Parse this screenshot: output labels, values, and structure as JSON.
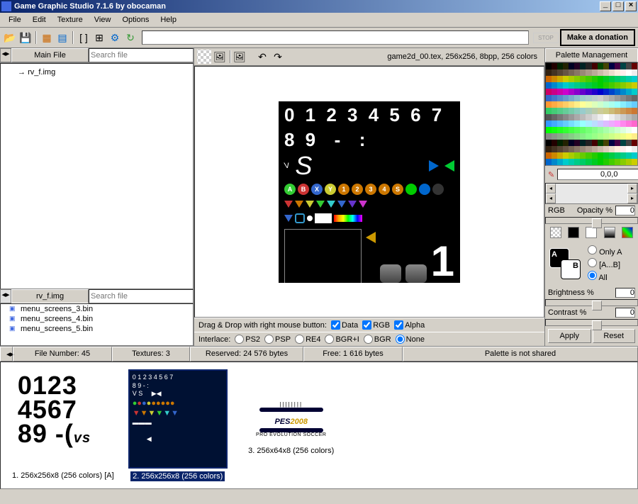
{
  "window": {
    "title": "Game Graphic Studio 7.1.6 by obocaman"
  },
  "menu": {
    "file": "File",
    "edit": "Edit",
    "texture": "Texture",
    "view": "View",
    "options": "Options",
    "help": "Help"
  },
  "toolbar": {
    "search_placeholder": "",
    "stop": "STOP",
    "donate": "Make a donation"
  },
  "left": {
    "main_file": "Main File",
    "search_placeholder": "Search file",
    "tree_item": "rv_f.img",
    "sub_current": "rv_f.img",
    "sub_search": "Search file",
    "sublist": [
      "menu_screens_3.bin",
      "menu_screens_4.bin",
      "menu_screens_5.bin"
    ]
  },
  "center": {
    "info": "game2d_00.tex, 256x256, 8bpp, 256 colors",
    "drag_label": "Drag & Drop with right mouse button:",
    "cb_data": "Data",
    "cb_rgb": "RGB",
    "cb_alpha": "Alpha",
    "interlace_label": "Interlace:",
    "radios": [
      "PS2",
      "PSP",
      "RE4",
      "BGR+I",
      "BGR",
      "None"
    ]
  },
  "right": {
    "header": "Palette Management",
    "color_value": "0,0,0",
    "rgb_label": "RGB",
    "opacity_label": "Opacity %",
    "opacity_val": "0",
    "radio_a": "Only A",
    "radio_ab": "[A...B]",
    "radio_all": "All",
    "brightness": "Brightness %",
    "brightness_val": "0",
    "contrast": "Contrast %",
    "contrast_val": "0",
    "apply": "Apply",
    "reset": "Reset"
  },
  "bottom": {
    "file_number": "File Number: 45",
    "textures": "Textures: 3",
    "reserved": "Reserved: 24 576 bytes",
    "free": "Free: 1 616 bytes",
    "palette_shared": "Palette is not shared",
    "thumbs": [
      {
        "label": "1. 256x256x8 (256 colors) [A]"
      },
      {
        "label": "2. 256x256x8 (256 colors)"
      },
      {
        "label": "3. 256x64x8 (256 colors)"
      }
    ]
  }
}
